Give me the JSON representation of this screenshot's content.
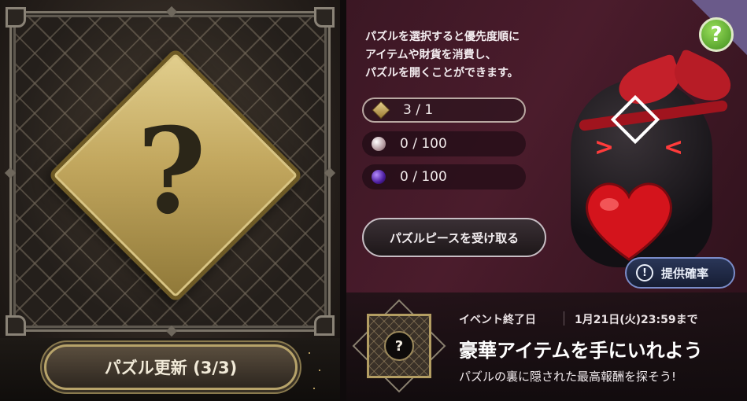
{
  "left_panel": {
    "puzzle_symbol": "?",
    "refresh_button_label": "パズル更新 (3/3)"
  },
  "right_panel": {
    "help_label": "?",
    "description_lines": [
      "パズルを選択すると優先度順に",
      "アイテムや財貨を消費し、",
      "パズルを開くことができます。"
    ],
    "resources": [
      {
        "icon": "gold-diamond-icon",
        "value": "3 / 1"
      },
      {
        "icon": "pearl-icon",
        "value": "0 / 100"
      },
      {
        "icon": "purple-orb-icon",
        "value": "0 / 100"
      }
    ],
    "receive_button_label": "パズルピースを受け取る",
    "rates_button": {
      "icon": "!",
      "label": "提供確率"
    }
  },
  "event": {
    "thumbnail_symbol": "?",
    "end_label": "イベント終了日",
    "end_date": "1月21日(火)23:59まで",
    "title": "豪華アイテムを手にいれよう",
    "subtitle": "パズルの裏に隠された最高報酬を探そう!"
  },
  "colors": {
    "accent_gold": "#c2a75e",
    "panel_bg": "#4b1c2c",
    "help_green": "#3f8d1d",
    "rates_blue": "#2a3658"
  }
}
